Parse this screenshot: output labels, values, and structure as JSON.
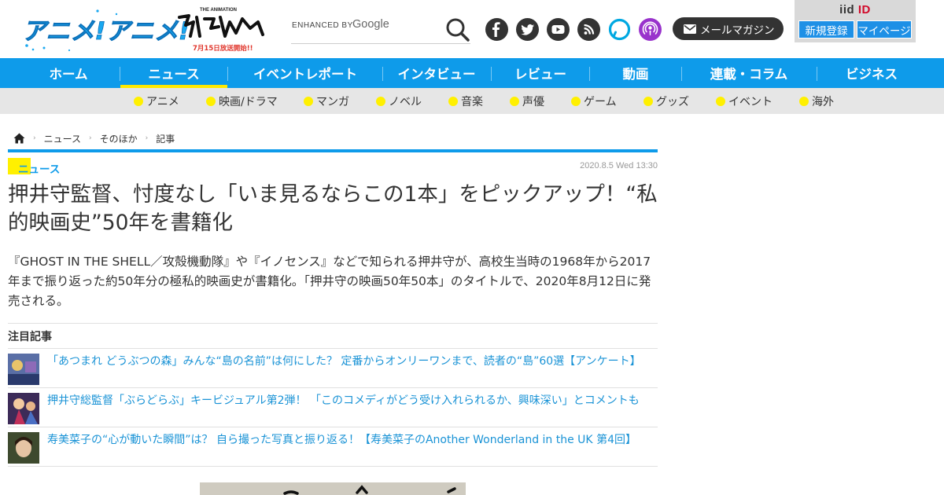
{
  "site": {
    "logo_text": "アニメ!アニメ!",
    "logo_sub_title": "THE ANIMATION",
    "logo_promo": "7月15日放送開始!!"
  },
  "search": {
    "enhanced_label": "ENHANCED BY",
    "google_label": "Google",
    "icon": "search-icon"
  },
  "social": [
    {
      "name": "facebook-icon",
      "color": "#333333"
    },
    {
      "name": "twitter-icon",
      "color": "#333333"
    },
    {
      "name": "youtube-icon",
      "color": "#333333"
    },
    {
      "name": "rss-icon",
      "color": "#333333"
    },
    {
      "name": "alexa-icon",
      "color": "#00a8e1"
    },
    {
      "name": "podcast-icon",
      "color": "#9933cc"
    }
  ],
  "mail_magazine": {
    "label": "メールマガジン",
    "icon": "mail-icon"
  },
  "iid": {
    "logo_main": "iid",
    "logo_id": "ID",
    "register_label": "新規登録",
    "mypage_label": "マイページ"
  },
  "nav": {
    "items": [
      {
        "label": "ホーム"
      },
      {
        "label": "ニュース",
        "active": true
      },
      {
        "label": "イベントレポート"
      },
      {
        "label": "インタビュー"
      },
      {
        "label": "レビュー"
      },
      {
        "label": "動画"
      },
      {
        "label": "連載・コラム"
      },
      {
        "label": "ビジネス"
      }
    ],
    "bg_color": "#0e9bea",
    "active_underline_color": "#ffe800"
  },
  "subnav": {
    "items": [
      {
        "label": "アニメ"
      },
      {
        "label": "映画/ドラマ"
      },
      {
        "label": "マンガ"
      },
      {
        "label": "ノベル"
      },
      {
        "label": "音楽"
      },
      {
        "label": "声優"
      },
      {
        "label": "ゲーム"
      },
      {
        "label": "グッズ"
      },
      {
        "label": "イベント"
      },
      {
        "label": "海外"
      }
    ]
  },
  "breadcrumb": {
    "home_icon": "home-icon",
    "items": [
      {
        "label": "ニュース"
      },
      {
        "label": "そのほか"
      },
      {
        "label": "記事"
      }
    ]
  },
  "article": {
    "category": "ニュース",
    "date": "2020.8.5 Wed 13:30",
    "title": "押井守監督、忖度なし「いま見るならこの1本」をピックアップ！“私的映画史”50年を書籍化",
    "lead": "『GHOST IN THE SHELL／攻殻機動隊』や『イノセンス』などで知られる押井守が、高校生当時の1968年から2017年まで振り返った約50年分の極私的映画史が書籍化。「押井守の映画50年50本」のタイトルで、2020年8月12日に発売される。"
  },
  "featured": {
    "heading": "注目記事",
    "items": [
      {
        "title": "「あつまれ どうぶつの森」みんな“島の名前”は何にした？ 定番からオンリーワンまで、読者の“島”60選【アンケート】"
      },
      {
        "title": "押井守総監督「ぶらどらぶ」キービジュアル第2弾！ 「このコメディがどう受け入れられるか、興味深い」とコメントも"
      },
      {
        "title": "寿美菜子の“心が動いた瞬間”は？ 自ら撮った写真と振り返る！【寿美菜子のAnother Wonderland in the UK 第4回】"
      }
    ]
  }
}
